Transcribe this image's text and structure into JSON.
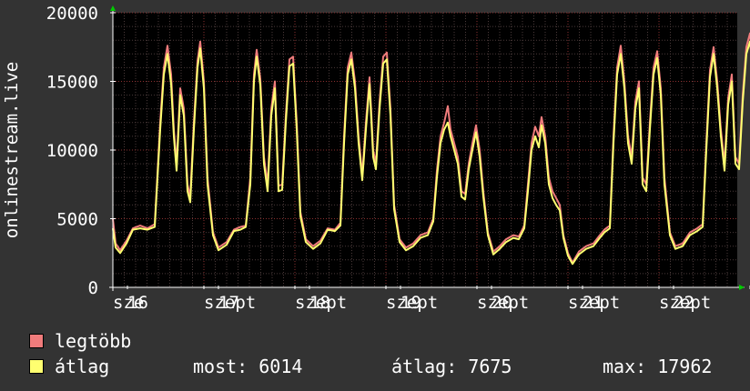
{
  "chart_data": {
    "type": "line",
    "ylabel": "onlinestream.live",
    "ylim": [
      0,
      20000
    ],
    "yticks": [
      {
        "value": 0,
        "label": "0"
      },
      {
        "value": 5000,
        "label": "5000"
      },
      {
        "value": 10000,
        "label": "10000"
      },
      {
        "value": 15000,
        "label": "15000"
      },
      {
        "value": 20000,
        "label": "20000"
      }
    ],
    "xlim": [
      0,
      8
    ],
    "xticks": [
      {
        "value": 0.0,
        "label": "sze"
      },
      {
        "value": 0.16,
        "label": "16"
      },
      {
        "value": 1.0,
        "label": "szept"
      },
      {
        "value": 1.16,
        "label": "17"
      },
      {
        "value": 2.0,
        "label": "szept"
      },
      {
        "value": 2.16,
        "label": "18"
      },
      {
        "value": 3.0,
        "label": "szept"
      },
      {
        "value": 3.16,
        "label": "19"
      },
      {
        "value": 4.0,
        "label": "szept"
      },
      {
        "value": 4.16,
        "label": "20"
      },
      {
        "value": 5.0,
        "label": "szept"
      },
      {
        "value": 5.16,
        "label": "21"
      },
      {
        "value": 6.0,
        "label": "szept"
      },
      {
        "value": 6.16,
        "label": "22"
      },
      {
        "value": 7.0,
        "label": "szep"
      }
    ],
    "grid": true,
    "series": [
      {
        "name": "legtöbb",
        "color": "#f07c7c",
        "values": [
          [
            0.0,
            5000
          ],
          [
            0.03,
            3200
          ],
          [
            0.08,
            2700
          ],
          [
            0.15,
            3400
          ],
          [
            0.22,
            4300
          ],
          [
            0.3,
            4500
          ],
          [
            0.38,
            4300
          ],
          [
            0.46,
            4600
          ],
          [
            0.52,
            12000
          ],
          [
            0.56,
            16000
          ],
          [
            0.6,
            17600
          ],
          [
            0.64,
            15500
          ],
          [
            0.67,
            11500
          ],
          [
            0.7,
            9000
          ],
          [
            0.74,
            14500
          ],
          [
            0.78,
            13000
          ],
          [
            0.82,
            7500
          ],
          [
            0.85,
            6600
          ],
          [
            0.89,
            12000
          ],
          [
            0.93,
            16500
          ],
          [
            0.96,
            17900
          ],
          [
            1.0,
            15000
          ],
          [
            1.04,
            8000
          ],
          [
            1.1,
            4000
          ],
          [
            1.16,
            2900
          ],
          [
            1.25,
            3300
          ],
          [
            1.33,
            4200
          ],
          [
            1.4,
            4400
          ],
          [
            1.46,
            4500
          ],
          [
            1.51,
            8000
          ],
          [
            1.55,
            15500
          ],
          [
            1.58,
            17300
          ],
          [
            1.62,
            15200
          ],
          [
            1.66,
            9500
          ],
          [
            1.7,
            7500
          ],
          [
            1.74,
            13000
          ],
          [
            1.78,
            15000
          ],
          [
            1.82,
            7400
          ],
          [
            1.86,
            7500
          ],
          [
            1.9,
            12500
          ],
          [
            1.94,
            16600
          ],
          [
            1.98,
            16800
          ],
          [
            2.02,
            12000
          ],
          [
            2.06,
            5500
          ],
          [
            2.12,
            3500
          ],
          [
            2.2,
            3000
          ],
          [
            2.28,
            3400
          ],
          [
            2.36,
            4300
          ],
          [
            2.44,
            4200
          ],
          [
            2.5,
            4700
          ],
          [
            2.54,
            11000
          ],
          [
            2.58,
            16000
          ],
          [
            2.62,
            17100
          ],
          [
            2.66,
            15000
          ],
          [
            2.7,
            11000
          ],
          [
            2.74,
            8200
          ],
          [
            2.78,
            12000
          ],
          [
            2.82,
            15300
          ],
          [
            2.86,
            10000
          ],
          [
            2.89,
            9000
          ],
          [
            2.93,
            13500
          ],
          [
            2.97,
            16800
          ],
          [
            3.01,
            17100
          ],
          [
            3.05,
            13000
          ],
          [
            3.09,
            6000
          ],
          [
            3.15,
            3500
          ],
          [
            3.22,
            2900
          ],
          [
            3.3,
            3200
          ],
          [
            3.38,
            3800
          ],
          [
            3.46,
            4000
          ],
          [
            3.52,
            5000
          ],
          [
            3.56,
            8500
          ],
          [
            3.6,
            11000
          ],
          [
            3.64,
            12000
          ],
          [
            3.68,
            13200
          ],
          [
            3.71,
            11500
          ],
          [
            3.75,
            10500
          ],
          [
            3.79,
            9500
          ],
          [
            3.83,
            7000
          ],
          [
            3.87,
            6800
          ],
          [
            3.91,
            9000
          ],
          [
            3.95,
            10500
          ],
          [
            3.99,
            11800
          ],
          [
            4.03,
            10000
          ],
          [
            4.07,
            7000
          ],
          [
            4.12,
            4000
          ],
          [
            4.18,
            2600
          ],
          [
            4.25,
            3000
          ],
          [
            4.32,
            3500
          ],
          [
            4.4,
            3800
          ],
          [
            4.46,
            3700
          ],
          [
            4.52,
            4500
          ],
          [
            4.56,
            7500
          ],
          [
            4.6,
            10500
          ],
          [
            4.64,
            11700
          ],
          [
            4.68,
            11000
          ],
          [
            4.71,
            12400
          ],
          [
            4.75,
            11000
          ],
          [
            4.79,
            8000
          ],
          [
            4.83,
            7000
          ],
          [
            4.87,
            6500
          ],
          [
            4.91,
            6000
          ],
          [
            4.95,
            3800
          ],
          [
            5.0,
            2500
          ],
          [
            5.05,
            1800
          ],
          [
            5.12,
            2600
          ],
          [
            5.2,
            3000
          ],
          [
            5.28,
            3200
          ],
          [
            5.35,
            3800
          ],
          [
            5.4,
            4200
          ],
          [
            5.46,
            4500
          ],
          [
            5.5,
            11000
          ],
          [
            5.54,
            16000
          ],
          [
            5.58,
            17600
          ],
          [
            5.62,
            15000
          ],
          [
            5.66,
            11000
          ],
          [
            5.7,
            9500
          ],
          [
            5.74,
            13500
          ],
          [
            5.78,
            15000
          ],
          [
            5.82,
            8000
          ],
          [
            5.86,
            7500
          ],
          [
            5.9,
            12000
          ],
          [
            5.94,
            16000
          ],
          [
            5.98,
            17200
          ],
          [
            6.02,
            14500
          ],
          [
            6.06,
            8000
          ],
          [
            6.12,
            4000
          ],
          [
            6.18,
            3000
          ],
          [
            6.26,
            3200
          ],
          [
            6.34,
            4000
          ],
          [
            6.42,
            4300
          ],
          [
            6.48,
            4600
          ],
          [
            6.52,
            10500
          ],
          [
            6.56,
            15800
          ],
          [
            6.6,
            17500
          ],
          [
            6.64,
            15000
          ],
          [
            6.68,
            11500
          ],
          [
            6.72,
            9000
          ],
          [
            6.76,
            13800
          ],
          [
            6.8,
            15500
          ],
          [
            6.84,
            9500
          ],
          [
            6.88,
            9000
          ],
          [
            6.92,
            14000
          ],
          [
            6.96,
            17500
          ],
          [
            7.0,
            18500
          ],
          [
            7.04,
            16000
          ],
          [
            7.06,
            9000
          ],
          [
            7.07,
            6500
          ]
        ]
      },
      {
        "name": "átlag",
        "color": "#ffff70",
        "values": [
          [
            0.0,
            4300
          ],
          [
            0.03,
            2900
          ],
          [
            0.08,
            2500
          ],
          [
            0.15,
            3200
          ],
          [
            0.22,
            4200
          ],
          [
            0.3,
            4300
          ],
          [
            0.38,
            4200
          ],
          [
            0.46,
            4400
          ],
          [
            0.52,
            11500
          ],
          [
            0.56,
            15500
          ],
          [
            0.6,
            17000
          ],
          [
            0.64,
            14800
          ],
          [
            0.67,
            11000
          ],
          [
            0.7,
            8500
          ],
          [
            0.74,
            14000
          ],
          [
            0.78,
            12500
          ],
          [
            0.82,
            7000
          ],
          [
            0.85,
            6200
          ],
          [
            0.89,
            11500
          ],
          [
            0.93,
            16000
          ],
          [
            0.96,
            17400
          ],
          [
            1.0,
            14500
          ],
          [
            1.04,
            7500
          ],
          [
            1.1,
            3800
          ],
          [
            1.16,
            2700
          ],
          [
            1.25,
            3100
          ],
          [
            1.33,
            4100
          ],
          [
            1.4,
            4200
          ],
          [
            1.46,
            4400
          ],
          [
            1.51,
            7500
          ],
          [
            1.55,
            15000
          ],
          [
            1.58,
            16800
          ],
          [
            1.62,
            14700
          ],
          [
            1.66,
            9000
          ],
          [
            1.7,
            7000
          ],
          [
            1.74,
            12500
          ],
          [
            1.78,
            14500
          ],
          [
            1.82,
            7000
          ],
          [
            1.86,
            7100
          ],
          [
            1.9,
            12000
          ],
          [
            1.94,
            16100
          ],
          [
            1.98,
            16300
          ],
          [
            2.02,
            11500
          ],
          [
            2.06,
            5200
          ],
          [
            2.12,
            3300
          ],
          [
            2.2,
            2800
          ],
          [
            2.28,
            3200
          ],
          [
            2.36,
            4200
          ],
          [
            2.44,
            4100
          ],
          [
            2.5,
            4500
          ],
          [
            2.54,
            10500
          ],
          [
            2.58,
            15500
          ],
          [
            2.62,
            16600
          ],
          [
            2.66,
            14500
          ],
          [
            2.7,
            10500
          ],
          [
            2.74,
            7800
          ],
          [
            2.78,
            11500
          ],
          [
            2.82,
            14800
          ],
          [
            2.86,
            9500
          ],
          [
            2.89,
            8600
          ],
          [
            2.93,
            13000
          ],
          [
            2.97,
            16300
          ],
          [
            3.01,
            16600
          ],
          [
            3.05,
            12500
          ],
          [
            3.09,
            5700
          ],
          [
            3.15,
            3300
          ],
          [
            3.22,
            2700
          ],
          [
            3.3,
            3000
          ],
          [
            3.38,
            3600
          ],
          [
            3.46,
            3800
          ],
          [
            3.52,
            4800
          ],
          [
            3.56,
            8000
          ],
          [
            3.6,
            10500
          ],
          [
            3.64,
            11500
          ],
          [
            3.68,
            12000
          ],
          [
            3.71,
            11000
          ],
          [
            3.75,
            10000
          ],
          [
            3.79,
            9000
          ],
          [
            3.83,
            6600
          ],
          [
            3.87,
            6400
          ],
          [
            3.91,
            8600
          ],
          [
            3.95,
            10000
          ],
          [
            3.99,
            11300
          ],
          [
            4.03,
            9500
          ],
          [
            4.07,
            6600
          ],
          [
            4.12,
            3800
          ],
          [
            4.18,
            2400
          ],
          [
            4.25,
            2800
          ],
          [
            4.32,
            3300
          ],
          [
            4.4,
            3600
          ],
          [
            4.46,
            3500
          ],
          [
            4.52,
            4300
          ],
          [
            4.56,
            7000
          ],
          [
            4.6,
            10000
          ],
          [
            4.64,
            11000
          ],
          [
            4.68,
            10200
          ],
          [
            4.71,
            11800
          ],
          [
            4.75,
            10500
          ],
          [
            4.79,
            7500
          ],
          [
            4.83,
            6500
          ],
          [
            4.87,
            6000
          ],
          [
            4.91,
            5600
          ],
          [
            4.95,
            3600
          ],
          [
            5.0,
            2300
          ],
          [
            5.05,
            1700
          ],
          [
            5.12,
            2400
          ],
          [
            5.2,
            2800
          ],
          [
            5.28,
            3000
          ],
          [
            5.35,
            3600
          ],
          [
            5.4,
            4000
          ],
          [
            5.46,
            4300
          ],
          [
            5.5,
            10500
          ],
          [
            5.54,
            15500
          ],
          [
            5.58,
            17000
          ],
          [
            5.62,
            14500
          ],
          [
            5.66,
            10500
          ],
          [
            5.7,
            9000
          ],
          [
            5.74,
            13000
          ],
          [
            5.78,
            14500
          ],
          [
            5.82,
            7500
          ],
          [
            5.86,
            7000
          ],
          [
            5.9,
            11500
          ],
          [
            5.94,
            15500
          ],
          [
            5.98,
            16700
          ],
          [
            6.02,
            14000
          ],
          [
            6.06,
            7500
          ],
          [
            6.12,
            3800
          ],
          [
            6.18,
            2800
          ],
          [
            6.26,
            3000
          ],
          [
            6.34,
            3800
          ],
          [
            6.42,
            4100
          ],
          [
            6.48,
            4400
          ],
          [
            6.52,
            10000
          ],
          [
            6.56,
            15300
          ],
          [
            6.6,
            17000
          ],
          [
            6.64,
            14500
          ],
          [
            6.68,
            11000
          ],
          [
            6.72,
            8500
          ],
          [
            6.76,
            13300
          ],
          [
            6.8,
            15000
          ],
          [
            6.84,
            9000
          ],
          [
            6.88,
            8600
          ],
          [
            6.92,
            13500
          ],
          [
            6.96,
            17000
          ],
          [
            7.0,
            17900
          ],
          [
            7.04,
            15500
          ],
          [
            7.06,
            8500
          ],
          [
            7.07,
            6014
          ]
        ]
      }
    ]
  },
  "legend": {
    "max_label": "legtöbb",
    "avg_label": "átlag",
    "max_color": "#f07c7c",
    "avg_color": "#ffff70"
  },
  "stats": {
    "current": "most: 6014",
    "average": "átlag: 7675",
    "maximum": "max: 17962"
  }
}
